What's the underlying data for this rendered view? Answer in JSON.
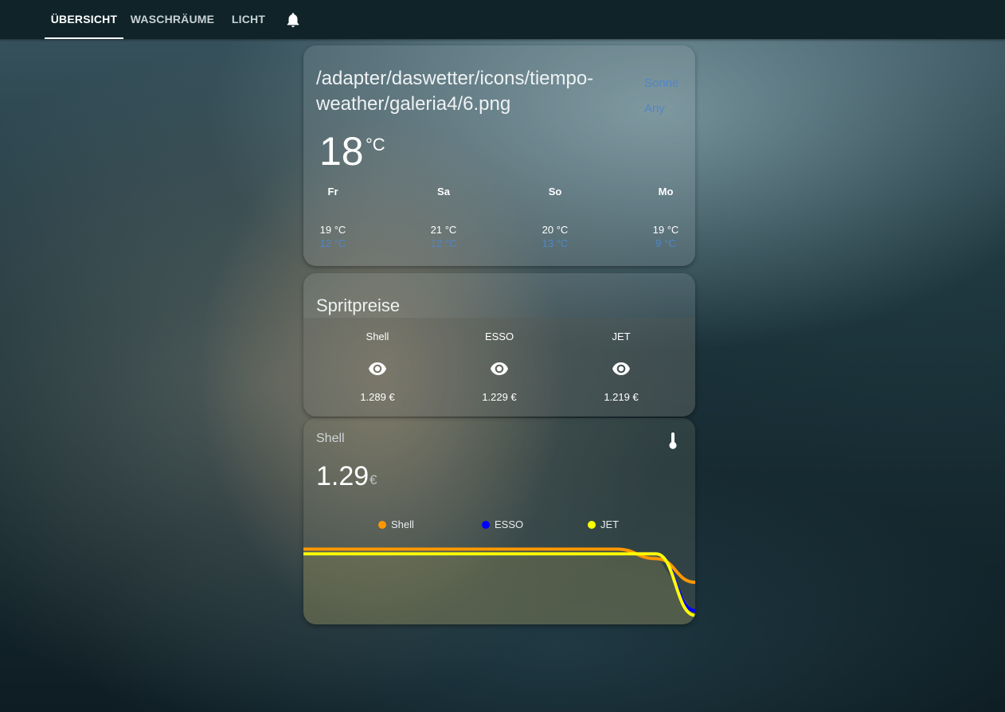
{
  "nav": {
    "tabs": [
      {
        "label": "ÜBERSICHT",
        "active": true
      },
      {
        "label": "WASCHRÄUME",
        "active": false
      },
      {
        "label": "LICHT",
        "active": false
      }
    ],
    "notification_icon": "bell-icon"
  },
  "weather": {
    "image_path": "/adapter/daswetter/icons/tiempo-weather/galeria4/6.png",
    "side_labels": [
      "Sonne",
      "Any"
    ],
    "temperature": "18",
    "unit": "°C",
    "forecast": [
      {
        "day": "Fr",
        "high": "19 °C",
        "low": "12 °C"
      },
      {
        "day": "Sa",
        "high": "21 °C",
        "low": "12 °C"
      },
      {
        "day": "So",
        "high": "20 °C",
        "low": "13 °C"
      },
      {
        "day": "Mo",
        "high": "19 °C",
        "low": "9 °C"
      }
    ]
  },
  "fuel": {
    "title": "Spritpreise",
    "stations": [
      {
        "name": "Shell",
        "icon": "eye-icon",
        "price": "1.289 €"
      },
      {
        "name": "ESSO",
        "icon": "eye-icon",
        "price": "1.229 €"
      },
      {
        "name": "JET",
        "icon": "eye-icon",
        "price": "1.219 €"
      }
    ]
  },
  "sensor": {
    "label": "Shell",
    "icon": "thermometer-icon",
    "value": "1.29",
    "unit": "€"
  },
  "chart_data": {
    "type": "line",
    "title": "",
    "xlabel": "",
    "ylabel": "",
    "x": [
      0,
      1,
      2,
      3,
      4,
      5,
      6,
      7,
      8,
      9,
      10
    ],
    "series": [
      {
        "name": "Shell",
        "color": "#ff9800",
        "values": [
          1.359,
          1.359,
          1.359,
          1.359,
          1.359,
          1.359,
          1.359,
          1.359,
          1.359,
          1.339,
          1.289
        ]
      },
      {
        "name": "ESSO",
        "color": "#0000ff",
        "values": [
          1.349,
          1.349,
          1.349,
          1.349,
          1.349,
          1.349,
          1.349,
          1.349,
          1.349,
          1.349,
          1.229
        ]
      },
      {
        "name": "JET",
        "color": "#ffff00",
        "values": [
          1.349,
          1.349,
          1.349,
          1.349,
          1.349,
          1.349,
          1.349,
          1.349,
          1.349,
          1.349,
          1.219
        ]
      }
    ],
    "legend": "top-center",
    "grid": false,
    "ylim": [
      1.2,
      1.38
    ]
  }
}
